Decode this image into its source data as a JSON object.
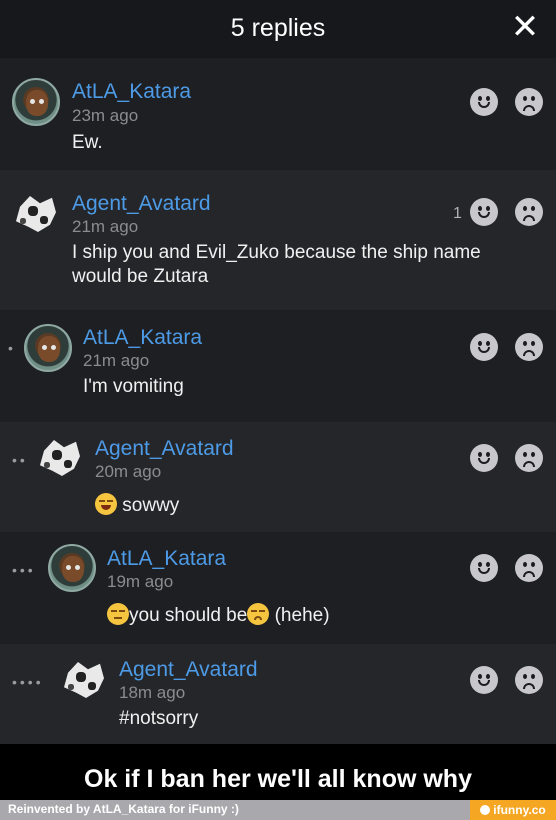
{
  "header": {
    "title": "5 replies",
    "close_glyph": "✕"
  },
  "comments": [
    {
      "user": "AtLA_Katara",
      "time": "23m ago",
      "text": "Ew.",
      "depth_dots": "",
      "avatar": "katara-avatar-icon",
      "likes": ""
    },
    {
      "user": "Agent_Avatard",
      "time": "21m ago",
      "text": "I ship you and Evil_Zuko because the ship name would be Zutara",
      "depth_dots": "",
      "avatar": "agent-avatar-icon",
      "likes": "1"
    },
    {
      "user": "AtLA_Katara",
      "time": "21m ago",
      "text": "I'm vomiting",
      "depth_dots": "•",
      "avatar": "katara-avatar-icon",
      "likes": ""
    },
    {
      "user": "Agent_Avatard",
      "time": "20m ago",
      "text": "sowwy",
      "depth_dots": "••",
      "avatar": "agent-avatar-icon",
      "likes": ""
    },
    {
      "user": "AtLA_Katara",
      "time": "19m ago",
      "text_a": "you should be",
      "text_b": "(hehe)",
      "depth_dots": "•••",
      "avatar": "katara-avatar-icon",
      "likes": ""
    },
    {
      "user": "Agent_Avatard",
      "time": "18m ago",
      "text": "#notsorry",
      "depth_dots": "••••",
      "avatar": "agent-avatar-icon",
      "likes": ""
    }
  ],
  "caption": "Ok if I ban her we'll all know why",
  "footer": {
    "left": "Reinvented by AtLA_Katara for iFunny :)",
    "right": "ifunny.co"
  },
  "colors": {
    "username": "#4d9be6",
    "background": "#1b1c20",
    "brand": "#f5a623"
  }
}
